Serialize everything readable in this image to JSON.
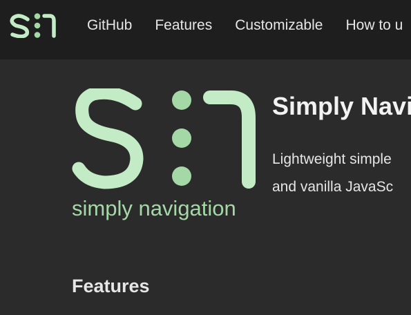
{
  "colors": {
    "navbar_bg": "#1e1e1e",
    "page_bg": "#2b2b2b",
    "brand_green": "#c3ebc5",
    "tagline_green": "#a5d8a7",
    "text": "#e6e6e6"
  },
  "nav": {
    "logo_icon": "sn-logo-icon",
    "links": [
      "GitHub",
      "Features",
      "Customizable",
      "How to u"
    ]
  },
  "hero": {
    "logo_icon": "sn-logo-icon",
    "tagline": "simply navigation",
    "title": "Simply Navi",
    "description": [
      "Lightweight simple",
      "and vanilla JavaSc"
    ]
  },
  "features": {
    "heading": "Features"
  }
}
